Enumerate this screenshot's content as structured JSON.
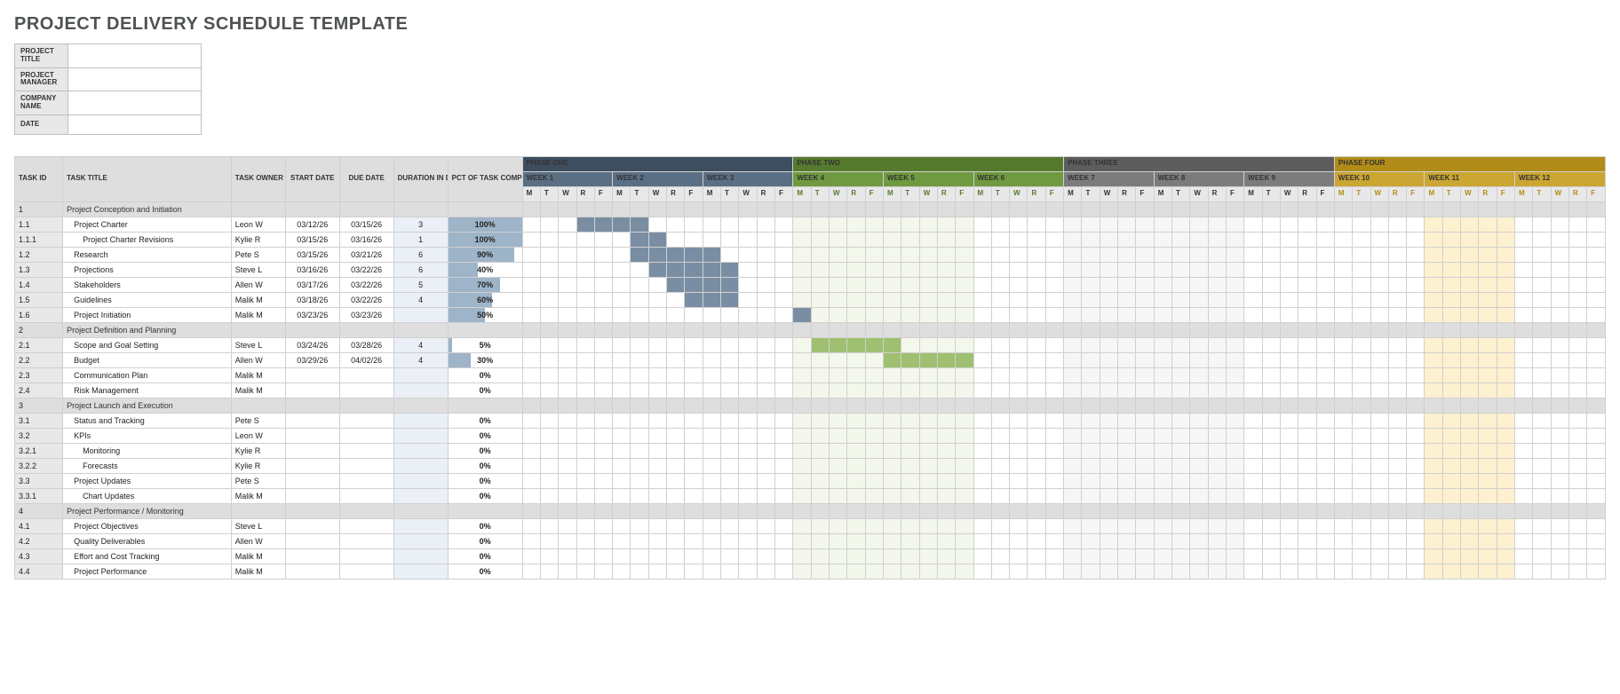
{
  "title": "PROJECT DELIVERY SCHEDULE TEMPLATE",
  "meta_labels": {
    "project_title": "PROJECT TITLE",
    "project_manager": "PROJECT MANAGER",
    "company_name": "COMPANY NAME",
    "date": "DATE"
  },
  "meta_values": {
    "project_title": "",
    "project_manager": "",
    "company_name": "",
    "date": ""
  },
  "columns": {
    "task_id": "TASK ID",
    "task_title": "TASK TITLE",
    "task_owner": "TASK OWNER",
    "start_date": "START DATE",
    "due_date": "DUE DATE",
    "duration": "DURATION IN DAYS",
    "pct": "PCT OF TASK COMPLETE"
  },
  "phases": [
    {
      "label": "PHASE ONE",
      "bg": "#3e4e5f",
      "weeks": [
        {
          "label": "WEEK 1",
          "bg": "#5b6f84",
          "day_bg": "#ffffff"
        },
        {
          "label": "WEEK 2",
          "bg": "#5b6f84",
          "day_bg": "#ffffff"
        },
        {
          "label": "WEEK 3",
          "bg": "#5b6f84",
          "day_bg": "#ffffff"
        }
      ]
    },
    {
      "label": "PHASE TWO",
      "bg": "#567a2d",
      "weeks": [
        {
          "label": "WEEK 4",
          "bg": "#6f9a3f",
          "day_bg": "#f3f7ec"
        },
        {
          "label": "WEEK 5",
          "bg": "#6f9a3f",
          "day_bg": "#f3f7ec"
        },
        {
          "label": "WEEK 6",
          "bg": "#6f9a3f",
          "day_bg": "#ffffff"
        }
      ]
    },
    {
      "label": "PHASE THREE",
      "bg": "#5d5d5d",
      "weeks": [
        {
          "label": "WEEK 7",
          "bg": "#7c7c7c",
          "day_bg": "#f6f6f6"
        },
        {
          "label": "WEEK 8",
          "bg": "#7c7c7c",
          "day_bg": "#f6f6f6"
        },
        {
          "label": "WEEK 9",
          "bg": "#7c7c7c",
          "day_bg": "#ffffff"
        }
      ]
    },
    {
      "label": "PHASE FOUR",
      "bg": "#b28c18",
      "weeks": [
        {
          "label": "WEEK 10",
          "bg": "#cba632",
          "day_bg": "#ffffff"
        },
        {
          "label": "WEEK 11",
          "bg": "#cba632",
          "day_bg": "#fdf1cf"
        },
        {
          "label": "WEEK 12",
          "bg": "#cba632",
          "day_bg": "#ffffff"
        }
      ]
    }
  ],
  "day_letters": [
    "M",
    "T",
    "W",
    "R",
    "F"
  ],
  "day_hdr_styles": {
    "p1": {
      "bg": "#e8e8e8",
      "fg": "#333333"
    },
    "p2": {
      "bg": "#e8e8e8",
      "fg": "#567a2d"
    },
    "p3": {
      "bg": "#e8e8e8",
      "fg": "#333333"
    },
    "p4": {
      "bg": "#e8e8e8",
      "fg": "#b28c18"
    }
  },
  "bar_colors": {
    "phase1": "#7a8ea3",
    "phase2": "#9fc070"
  },
  "tasks": [
    {
      "id": "1",
      "title": "Project Conception and Initiation",
      "owner": "",
      "start": "",
      "due": "",
      "dur": "",
      "pct": "",
      "indent": 0,
      "section": true,
      "bars": []
    },
    {
      "id": "1.1",
      "title": "Project Charter",
      "owner": "Leon W",
      "start": "03/12/26",
      "due": "03/15/26",
      "dur": "3",
      "pct": "100%",
      "indent": 1,
      "section": false,
      "bars": [
        {
          "start": 3,
          "len": 4,
          "color": "phase1"
        }
      ]
    },
    {
      "id": "1.1.1",
      "title": "Project Charter Revisions",
      "owner": "Kylie R",
      "start": "03/15/26",
      "due": "03/16/26",
      "dur": "1",
      "pct": "100%",
      "indent": 2,
      "section": false,
      "bars": [
        {
          "start": 6,
          "len": 2,
          "color": "phase1"
        }
      ]
    },
    {
      "id": "1.2",
      "title": "Research",
      "owner": "Pete S",
      "start": "03/15/26",
      "due": "03/21/26",
      "dur": "6",
      "pct": "90%",
      "indent": 1,
      "section": false,
      "bars": [
        {
          "start": 6,
          "len": 5,
          "color": "phase1"
        }
      ]
    },
    {
      "id": "1.3",
      "title": "Projections",
      "owner": "Steve L",
      "start": "03/16/26",
      "due": "03/22/26",
      "dur": "6",
      "pct": "40%",
      "indent": 1,
      "section": false,
      "bars": [
        {
          "start": 7,
          "len": 5,
          "color": "phase1"
        }
      ]
    },
    {
      "id": "1.4",
      "title": "Stakeholders",
      "owner": "Allen W",
      "start": "03/17/26",
      "due": "03/22/26",
      "dur": "5",
      "pct": "70%",
      "indent": 1,
      "section": false,
      "bars": [
        {
          "start": 8,
          "len": 4,
          "color": "phase1"
        }
      ]
    },
    {
      "id": "1.5",
      "title": "Guidelines",
      "owner": "Malik M",
      "start": "03/18/26",
      "due": "03/22/26",
      "dur": "4",
      "pct": "60%",
      "indent": 1,
      "section": false,
      "bars": [
        {
          "start": 9,
          "len": 3,
          "color": "phase1"
        }
      ]
    },
    {
      "id": "1.6",
      "title": "Project Initiation",
      "owner": "Malik M",
      "start": "03/23/26",
      "due": "03/23/26",
      "dur": "",
      "pct": "50%",
      "indent": 1,
      "section": false,
      "bars": [
        {
          "start": 15,
          "len": 1,
          "color": "phase1"
        }
      ]
    },
    {
      "id": "2",
      "title": "Project Definition and Planning",
      "owner": "",
      "start": "",
      "due": "",
      "dur": "",
      "pct": "",
      "indent": 0,
      "section": true,
      "bars": []
    },
    {
      "id": "2.1",
      "title": "Scope and Goal Setting",
      "owner": "Steve L",
      "start": "03/24/26",
      "due": "03/28/26",
      "dur": "4",
      "pct": "5%",
      "indent": 1,
      "section": false,
      "bars": [
        {
          "start": 16,
          "len": 5,
          "color": "phase2"
        }
      ]
    },
    {
      "id": "2.2",
      "title": "Budget",
      "owner": "Allen W",
      "start": "03/29/26",
      "due": "04/02/26",
      "dur": "4",
      "pct": "30%",
      "indent": 1,
      "section": false,
      "bars": [
        {
          "start": 20,
          "len": 5,
          "color": "phase2"
        }
      ]
    },
    {
      "id": "2.3",
      "title": "Communication Plan",
      "owner": "Malik M",
      "start": "",
      "due": "",
      "dur": "",
      "pct": "0%",
      "indent": 1,
      "section": false,
      "bars": []
    },
    {
      "id": "2.4",
      "title": "Risk Management",
      "owner": "Malik M",
      "start": "",
      "due": "",
      "dur": "",
      "pct": "0%",
      "indent": 1,
      "section": false,
      "bars": []
    },
    {
      "id": "3",
      "title": "Project Launch and Execution",
      "owner": "",
      "start": "",
      "due": "",
      "dur": "",
      "pct": "",
      "indent": 0,
      "section": true,
      "bars": []
    },
    {
      "id": "3.1",
      "title": "Status and Tracking",
      "owner": "Pete S",
      "start": "",
      "due": "",
      "dur": "",
      "pct": "0%",
      "indent": 1,
      "section": false,
      "bars": []
    },
    {
      "id": "3.2",
      "title": "KPIs",
      "owner": "Leon W",
      "start": "",
      "due": "",
      "dur": "",
      "pct": "0%",
      "indent": 1,
      "section": false,
      "bars": []
    },
    {
      "id": "3.2.1",
      "title": "Monitoring",
      "owner": "Kylie R",
      "start": "",
      "due": "",
      "dur": "",
      "pct": "0%",
      "indent": 2,
      "section": false,
      "bars": []
    },
    {
      "id": "3.2.2",
      "title": "Forecasts",
      "owner": "Kylie R",
      "start": "",
      "due": "",
      "dur": "",
      "pct": "0%",
      "indent": 2,
      "section": false,
      "bars": []
    },
    {
      "id": "3.3",
      "title": "Project Updates",
      "owner": "Pete S",
      "start": "",
      "due": "",
      "dur": "",
      "pct": "0%",
      "indent": 1,
      "section": false,
      "bars": []
    },
    {
      "id": "3.3.1",
      "title": "Chart Updates",
      "owner": "Malik M",
      "start": "",
      "due": "",
      "dur": "",
      "pct": "0%",
      "indent": 2,
      "section": false,
      "bars": []
    },
    {
      "id": "4",
      "title": "Project Performance / Monitoring",
      "owner": "",
      "start": "",
      "due": "",
      "dur": "",
      "pct": "",
      "indent": 0,
      "section": true,
      "bars": []
    },
    {
      "id": "4.1",
      "title": "Project Objectives",
      "owner": "Steve L",
      "start": "",
      "due": "",
      "dur": "",
      "pct": "0%",
      "indent": 1,
      "section": false,
      "bars": []
    },
    {
      "id": "4.2",
      "title": "Quality Deliverables",
      "owner": "Allen W",
      "start": "",
      "due": "",
      "dur": "",
      "pct": "0%",
      "indent": 1,
      "section": false,
      "bars": []
    },
    {
      "id": "4.3",
      "title": "Effort and Cost Tracking",
      "owner": "Malik M",
      "start": "",
      "due": "",
      "dur": "",
      "pct": "0%",
      "indent": 1,
      "section": false,
      "bars": []
    },
    {
      "id": "4.4",
      "title": "Project Performance",
      "owner": "Malik M",
      "start": "",
      "due": "",
      "dur": "",
      "pct": "0%",
      "indent": 1,
      "section": false,
      "bars": []
    }
  ]
}
